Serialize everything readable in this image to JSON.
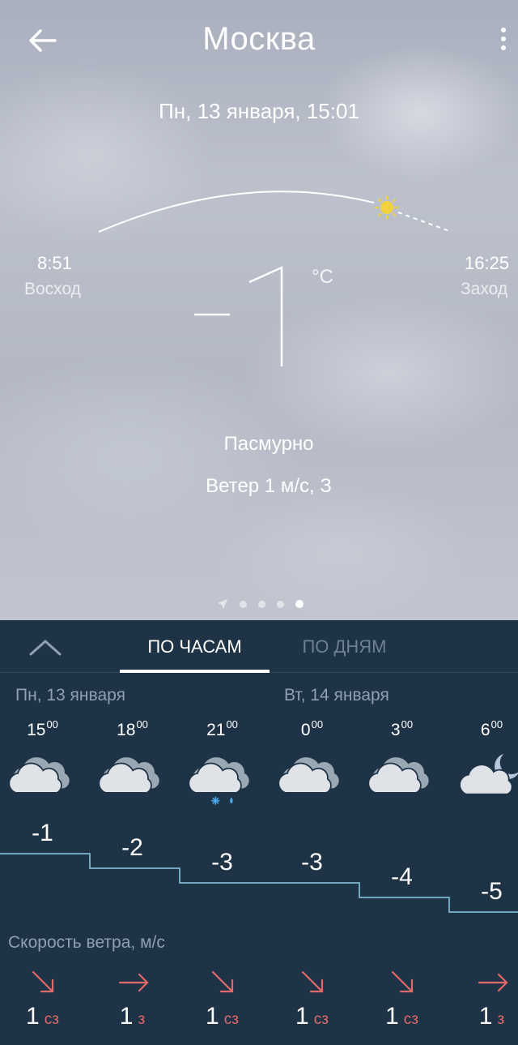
{
  "header": {
    "city": "Москва",
    "datetime": "Пн, 13 января, 15:01"
  },
  "sun": {
    "sunrise_time": "8:51",
    "sunrise_label": "Восход",
    "sunset_time": "16:25",
    "sunset_label": "Заход"
  },
  "current": {
    "temp": "−1",
    "unit": "°C",
    "condition": "Пасмурно",
    "wind": "Ветер 1 м/с, З"
  },
  "tabs": {
    "hourly": "ПО ЧАСАМ",
    "daily": "ПО ДНЯМ"
  },
  "days": {
    "day1": "Пн, 13 января",
    "day2": "Вт, 14 января"
  },
  "hours": [
    {
      "hour": "15",
      "min": "00",
      "icon": "cloudy-icon",
      "temp": "-1",
      "wind_speed": "1",
      "wind_dir": "сз"
    },
    {
      "hour": "18",
      "min": "00",
      "icon": "cloudy-icon",
      "temp": "-2",
      "wind_speed": "1",
      "wind_dir": "з"
    },
    {
      "hour": "21",
      "min": "00",
      "icon": "cloudy-snow-rain-icon",
      "temp": "-3",
      "wind_speed": "1",
      "wind_dir": "сз"
    },
    {
      "hour": "0",
      "min": "00",
      "icon": "cloudy-icon",
      "temp": "-3",
      "wind_speed": "1",
      "wind_dir": "сз"
    },
    {
      "hour": "3",
      "min": "00",
      "icon": "cloudy-icon",
      "temp": "-4",
      "wind_speed": "1",
      "wind_dir": "сз"
    },
    {
      "hour": "6",
      "min": "00",
      "icon": "cloudy-night-icon",
      "temp": "-5",
      "wind_speed": "1",
      "wind_dir": "з"
    }
  ],
  "wind_title": "Скорость ветра, м/с",
  "colors": {
    "panel_bg": "#1f3346",
    "graph_line": "#8ecbe8",
    "wind_arrow": "#e06a6a",
    "sun": "#f2d23c",
    "precip": "#4aa8e8"
  }
}
